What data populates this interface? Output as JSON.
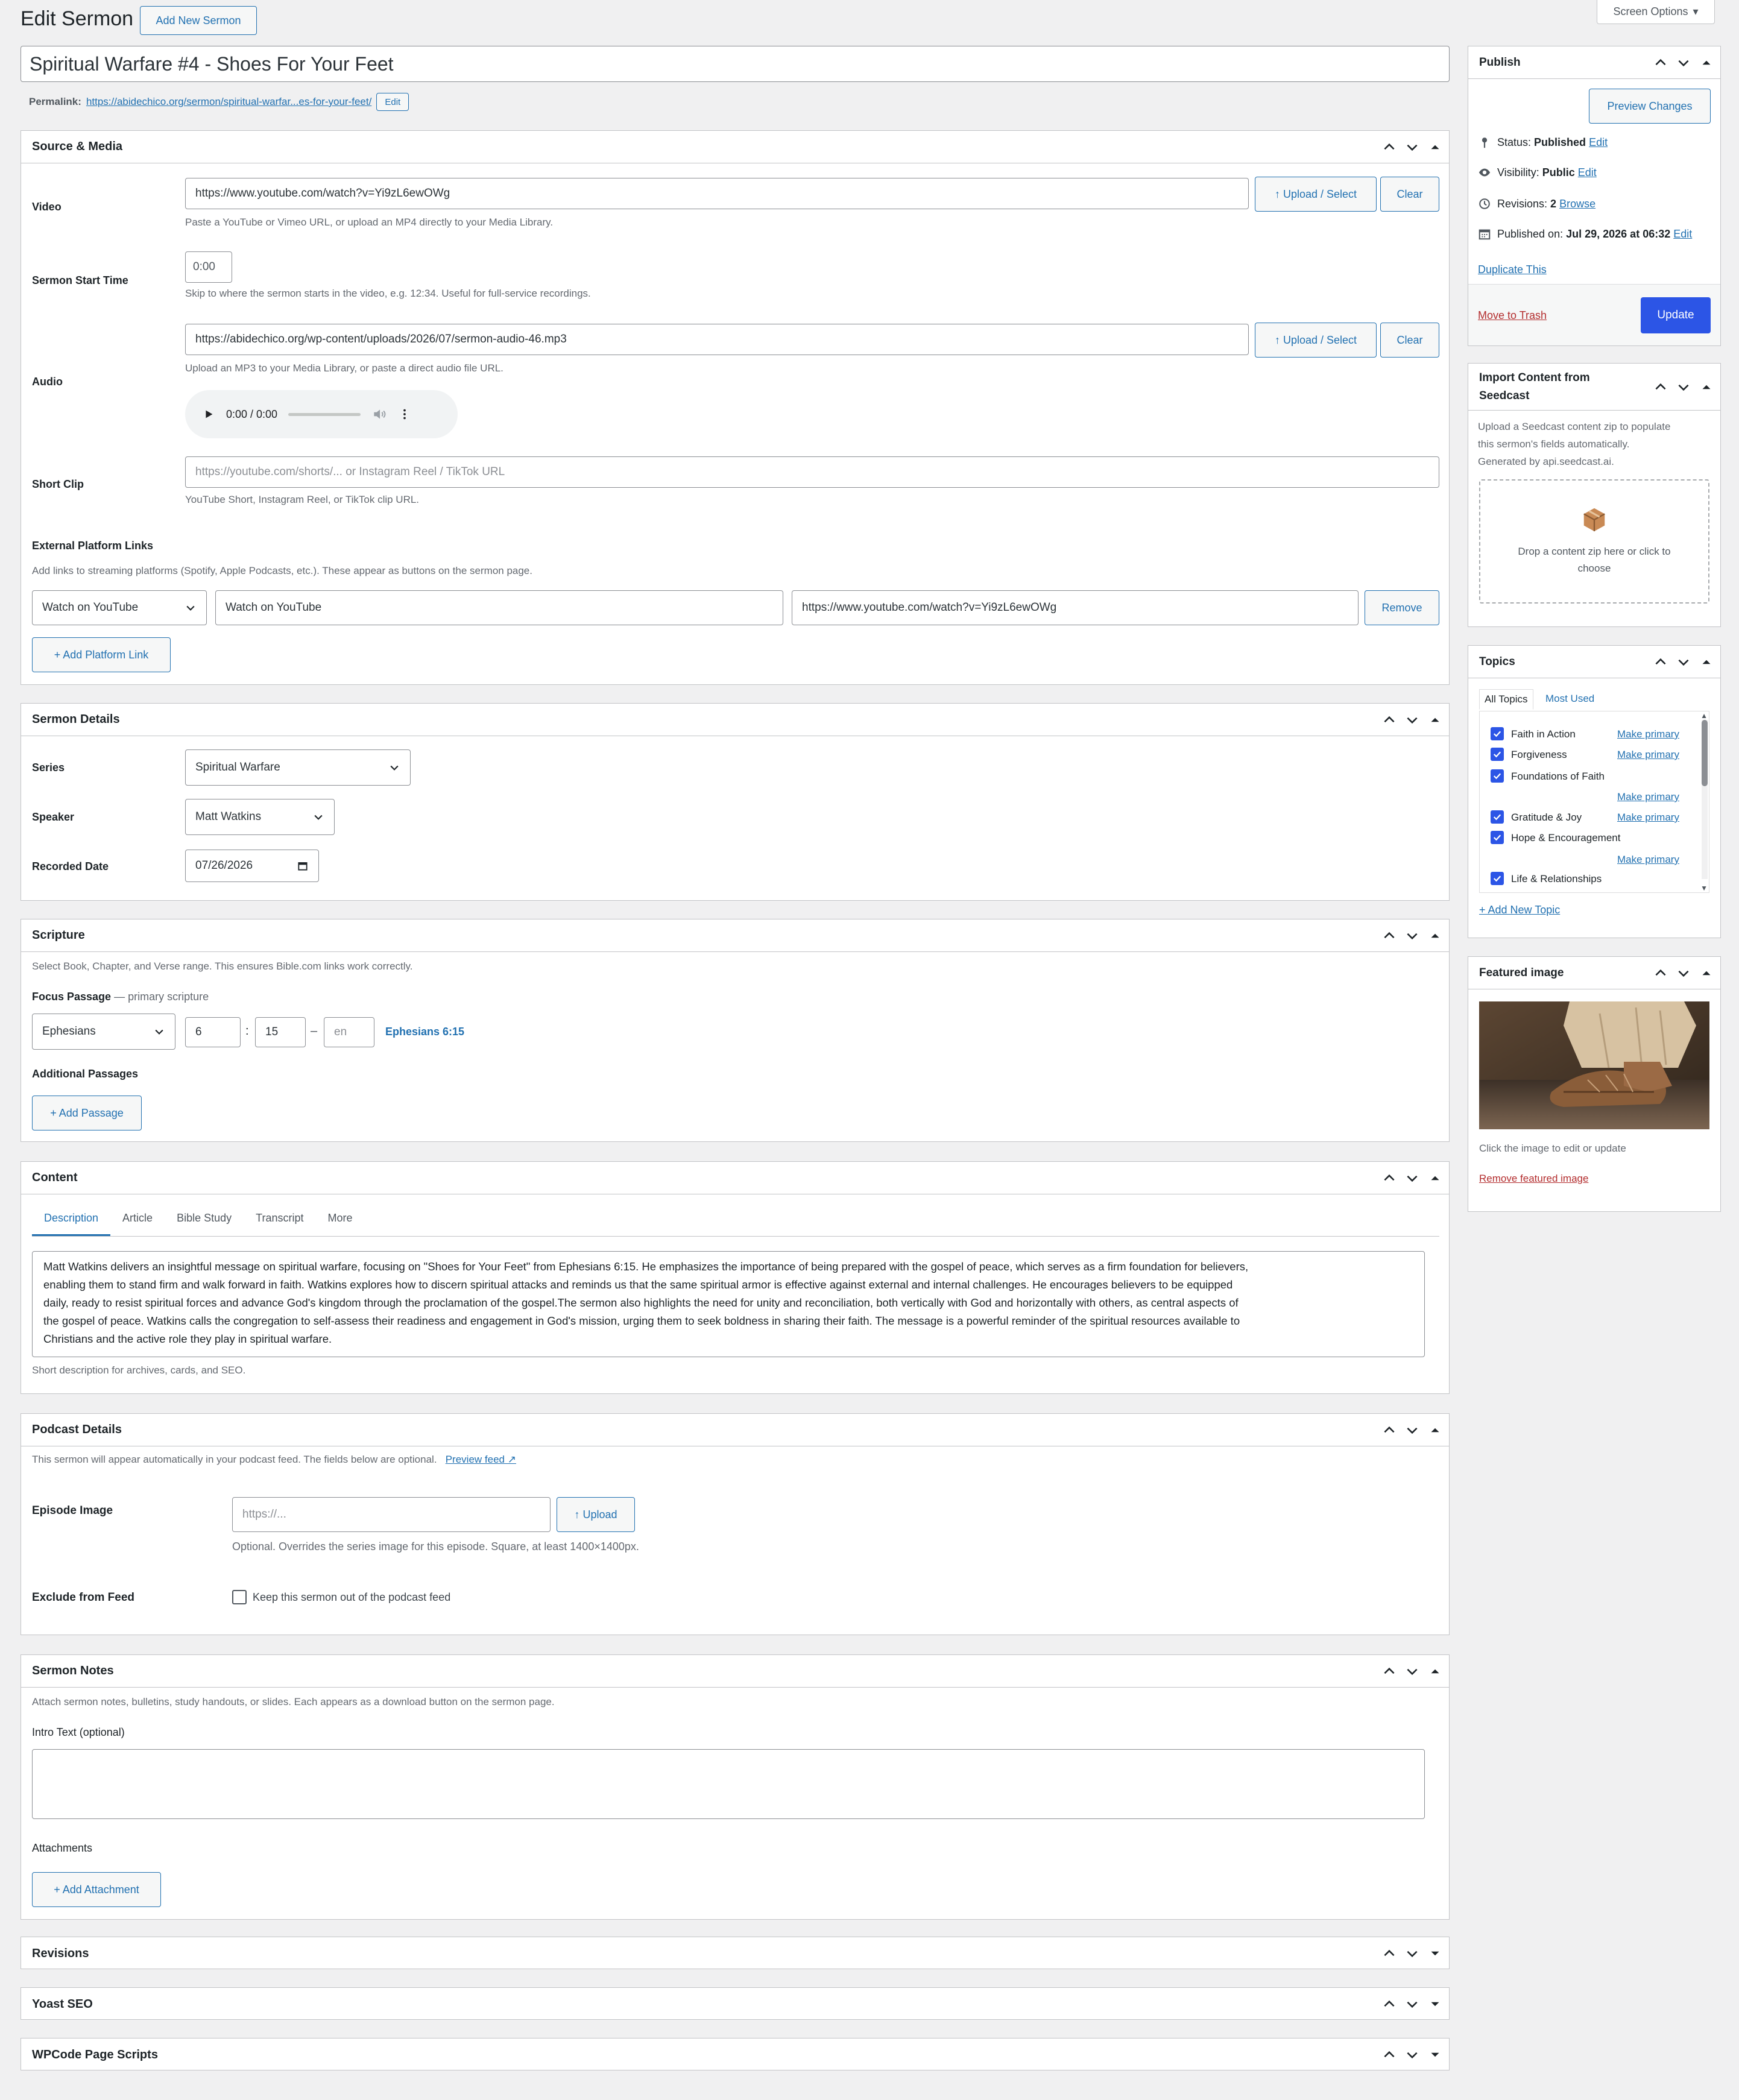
{
  "page": {
    "title": "Edit Sermon",
    "add_new": "Add New Sermon",
    "screen_options": "Screen Options"
  },
  "post": {
    "title": "Spiritual Warfare #4 - Shoes For Your Feet",
    "permalink_label": "Permalink:",
    "permalink_url": "https://abidechico.org/sermon/spiritual-warfar...es-for-your-feet/",
    "permalink_edit": "Edit"
  },
  "source_media": {
    "heading": "Source & Media",
    "video_label": "Video",
    "video_value": "https://www.youtube.com/watch?v=Yi9zL6ewOWg",
    "video_hint": "Paste a YouTube or Vimeo URL, or upload an MP4 directly to your Media Library.",
    "upload_select": "↑ Upload / Select",
    "clear": "Clear",
    "start_label": "Sermon Start Time",
    "start_value": "0:00",
    "start_hint": "Skip to where the sermon starts in the video, e.g. 12:34. Useful for full-service recordings.",
    "audio_label": "Audio",
    "audio_value": "https://abidechico.org/wp-content/uploads/2026/07/sermon-audio-46.mp3",
    "audio_hint": "Upload an MP3 to your Media Library, or paste a direct audio file URL.",
    "player_time": "0:00 / 0:00",
    "clip_label": "Short Clip",
    "clip_placeholder": "https://youtube.com/shorts/... or Instagram Reel / TikTok URL",
    "clip_hint": "YouTube Short, Instagram Reel, or TikTok clip URL.",
    "ext_label": "External Platform Links",
    "ext_hint": "Add links to streaming platforms (Spotify, Apple Podcasts, etc.). These appear as buttons on the sermon page.",
    "platform_select": "Watch on YouTube",
    "platform_label": "Watch on YouTube",
    "platform_url": "https://www.youtube.com/watch?v=Yi9zL6ewOWg",
    "remove": "Remove",
    "add_platform": "+ Add Platform Link"
  },
  "sermon_details": {
    "heading": "Sermon Details",
    "series_label": "Series",
    "series_value": "Spiritual Warfare",
    "speaker_label": "Speaker",
    "speaker_value": "Matt Watkins",
    "date_label": "Recorded Date",
    "date_value": "07/26/2026"
  },
  "scripture": {
    "heading": "Scripture",
    "hint": "Select Book, Chapter, and Verse range. This ensures Bible.com links work correctly.",
    "focus_label": "Focus Passage",
    "focus_sub": "— primary scripture",
    "book": "Ephesians",
    "chapter": "6",
    "verse": "15",
    "colon": ":",
    "dash": "–",
    "end_placeholder": "en",
    "ref": "Ephesians 6:15",
    "additional_label": "Additional Passages",
    "add_passage": "+ Add Passage"
  },
  "content": {
    "heading": "Content",
    "tabs": [
      "Description",
      "Article",
      "Bible Study",
      "Transcript",
      "More"
    ],
    "lines": [
      "Matt Watkins delivers an insightful message on spiritual warfare, focusing on \"Shoes for Your Feet\" from Ephesians 6:15. He emphasizes the importance of being prepared with the gospel of peace, which serves as a firm foundation for believers,",
      "enabling them to stand firm and walk forward in faith. Watkins explores how to discern spiritual attacks and reminds us that the same spiritual armor is effective against external and internal challenges. He encourages believers to be equipped",
      "daily, ready to resist spiritual forces and advance God's kingdom through the proclamation of the gospel.The sermon also highlights the need for unity and reconciliation, both vertically with God and horizontally with others, as central aspects of",
      "the gospel of peace. Watkins calls the congregation to self-assess their readiness and engagement in God's mission, urging them to seek boldness in sharing their faith. The message is a powerful reminder of the spiritual resources available to",
      "Christians and the active role they play in spiritual warfare."
    ],
    "hint": "Short description for archives, cards, and SEO."
  },
  "podcast": {
    "heading": "Podcast Details",
    "hint": "This sermon will appear automatically in your podcast feed. The fields below are optional.",
    "preview_feed": "Preview feed ↗",
    "episode_label": "Episode Image",
    "episode_placeholder": "https://...",
    "upload": "↑ Upload",
    "episode_hint": "Optional. Overrides the series image for this episode. Square, at least 1400×1400px.",
    "exclude_label": "Exclude from Feed",
    "exclude_text": "Keep this sermon out of the podcast feed"
  },
  "notes": {
    "heading": "Sermon Notes",
    "hint": "Attach sermon notes, bulletins, study handouts, or slides. Each appears as a download button on the sermon page.",
    "intro_label": "Intro Text (optional)",
    "attachments_label": "Attachments",
    "add_attachment": "+ Add Attachment"
  },
  "collapsed": {
    "revisions": "Revisions",
    "yoast": "Yoast SEO",
    "wpcode": "WPCode Page Scripts"
  },
  "publish": {
    "heading": "Publish",
    "preview": "Preview Changes",
    "status_label": "Status:",
    "status_value": "Published",
    "visibility_label": "Visibility:",
    "visibility_value": "Public",
    "revisions_label": "Revisions:",
    "revisions_value": "2",
    "browse": "Browse",
    "published_label": "Published on:",
    "published_value": "Jul 29, 2026 at 06:32",
    "edit": "Edit",
    "duplicate": "Duplicate This",
    "trash": "Move to Trash",
    "update": "Update"
  },
  "import": {
    "heading_1": "Import Content from",
    "heading_2": "Seedcast",
    "hint_1": "Upload a Seedcast content zip to populate",
    "hint_2": "this sermon's fields automatically.",
    "hint_3": "Generated by api.seedcast.ai.",
    "drop_1": "Drop a content zip here or click to",
    "drop_2": "choose"
  },
  "topics": {
    "heading": "Topics",
    "tab_all": "All Topics",
    "tab_most": "Most Used",
    "make_primary": "Make primary",
    "items": [
      "Faith in Action",
      "Forgiveness",
      "Foundations of Faith",
      "Gratitude & Joy",
      "Hope & Encouragement",
      "Life & Relationships"
    ],
    "add_new": "+ Add New Topic"
  },
  "featured": {
    "heading": "Featured image",
    "hint": "Click the image to edit or update",
    "remove": "Remove featured image"
  },
  "colors": {
    "accent": "#2c55e6",
    "link": "#2271b1",
    "danger": "#b32d2e",
    "bg": "#f0f0f1"
  }
}
